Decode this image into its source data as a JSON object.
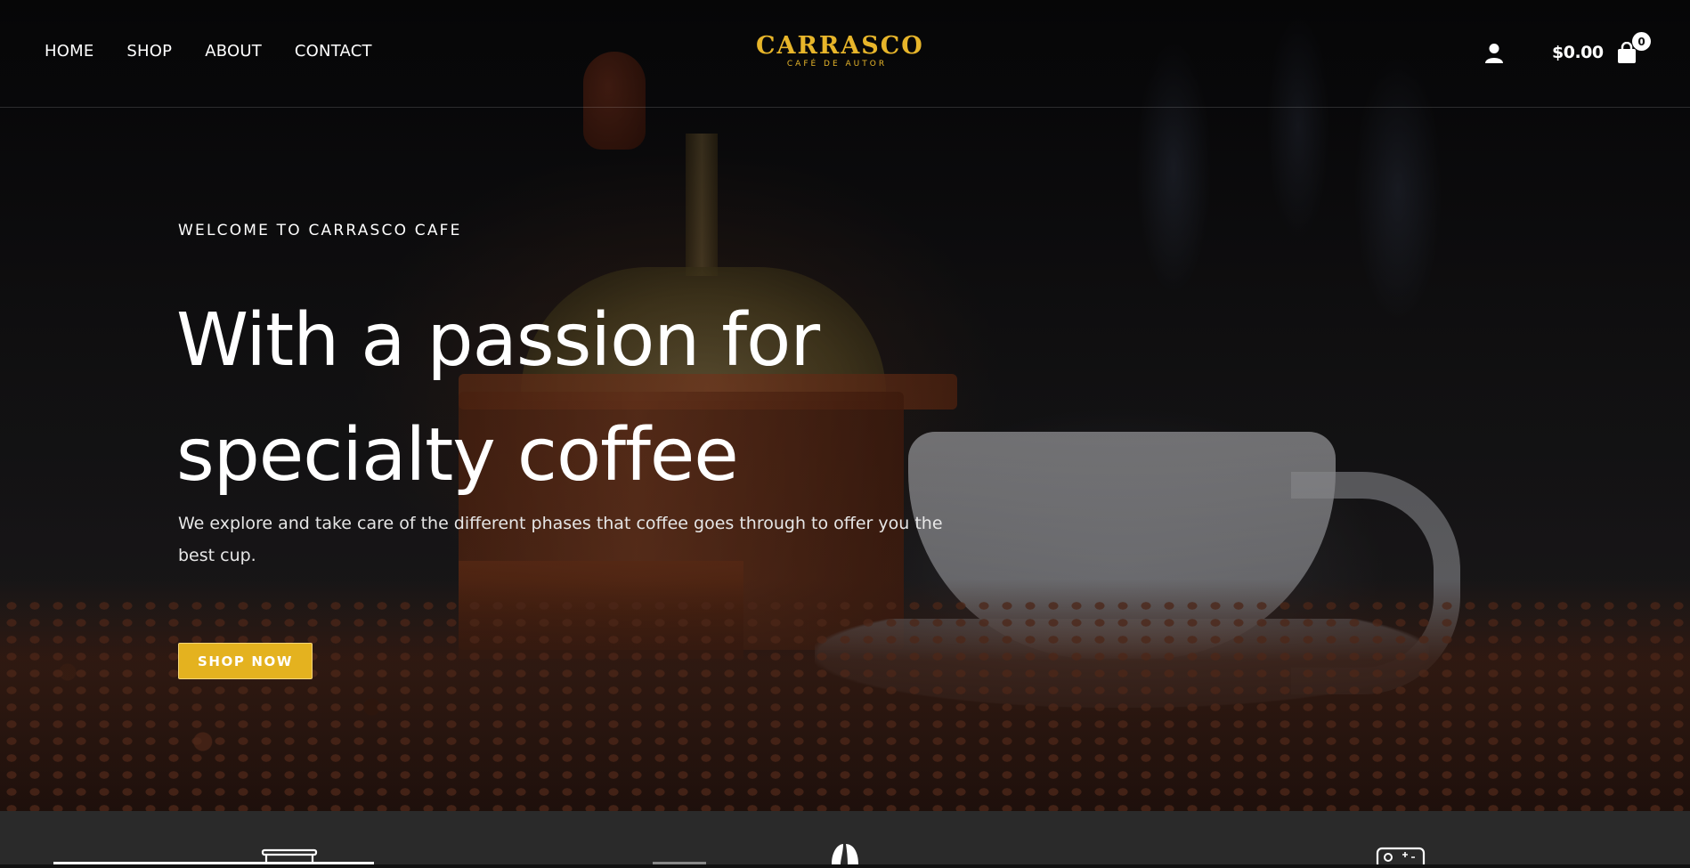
{
  "header": {
    "nav": [
      {
        "label": "HOME"
      },
      {
        "label": "SHOP"
      },
      {
        "label": "ABOUT"
      },
      {
        "label": "CONTACT"
      }
    ],
    "logo": {
      "main": "CARRASCO",
      "sub": "CAFÉ DE AUTOR"
    },
    "cart": {
      "total": "$0.00",
      "count": "0"
    },
    "icons": {
      "account": "user-icon",
      "cart": "shopping-bag-icon"
    }
  },
  "hero": {
    "eyebrow": "WELCOME TO CARRASCO CAFE",
    "headline_line1": "With a passion for",
    "headline_line2": "specialty coffee",
    "description": "We explore and take care of the different phases that coffee goes through to offer you the best cup.",
    "cta": "SHOP NOW"
  },
  "feature_strip": {
    "icons": [
      "coffee-maker-icon",
      "coffee-bean-icon",
      "coffee-machine-icon"
    ]
  },
  "colors": {
    "accent": "#e4b21f",
    "logo": "#e7b52a",
    "header_bg": "#0d0d10",
    "strip_bg": "#2a2a2a",
    "text": "#ffffff"
  }
}
